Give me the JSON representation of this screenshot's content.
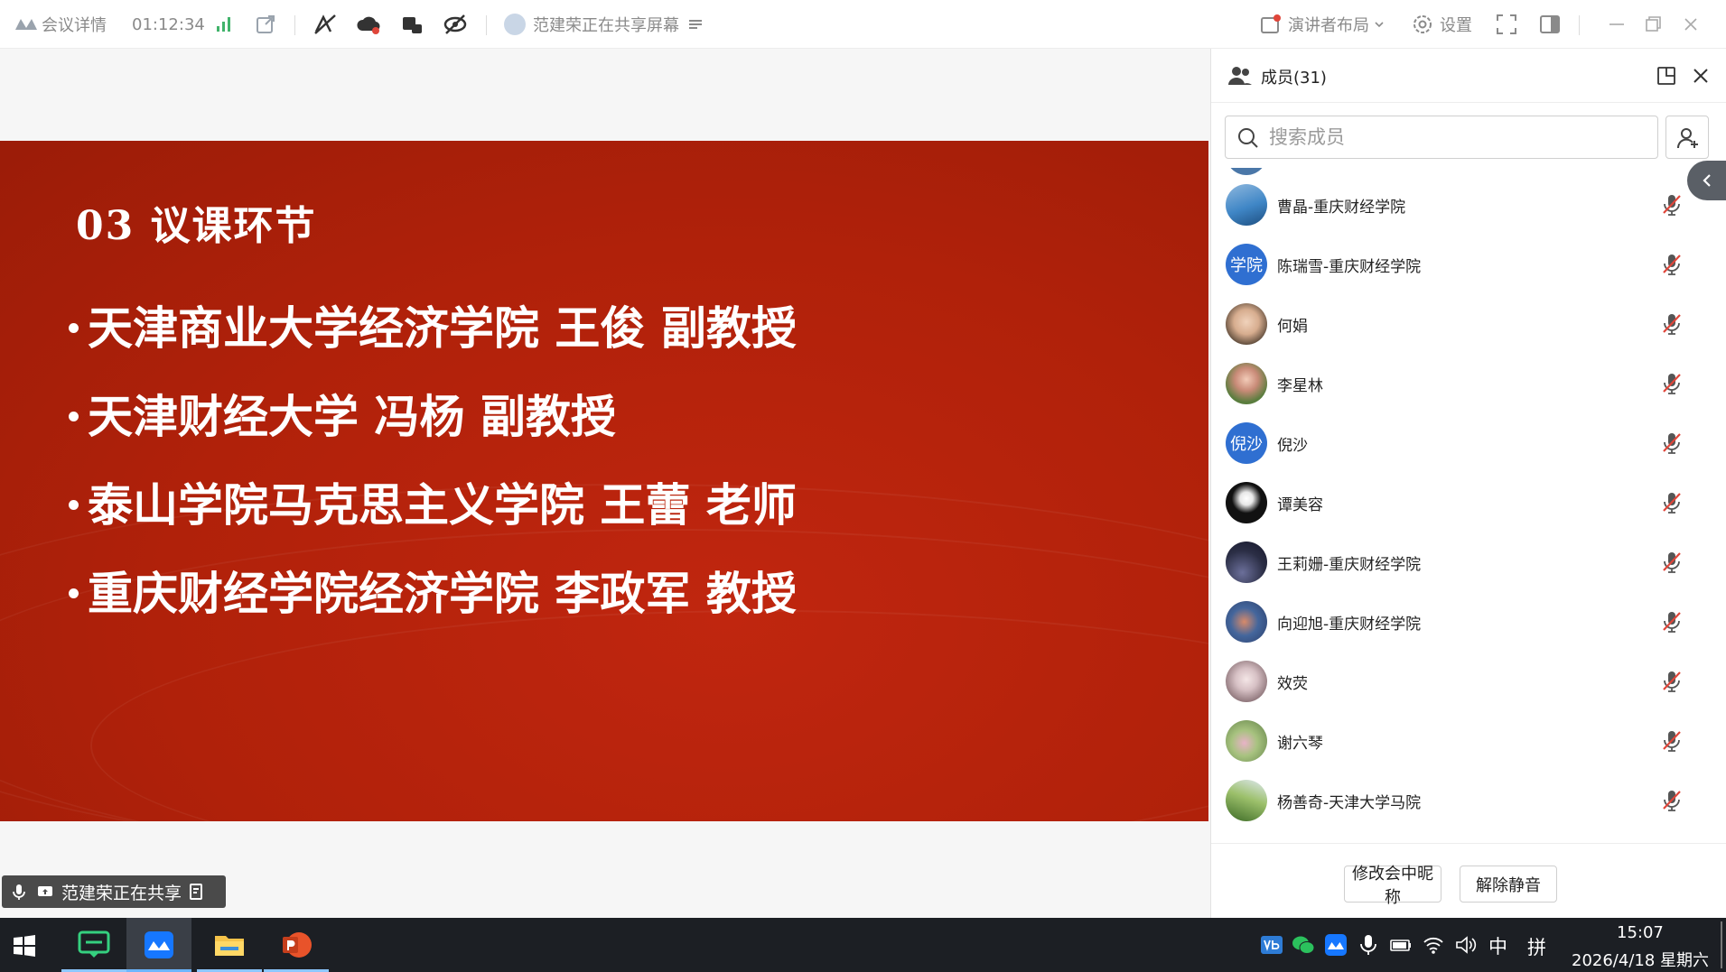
{
  "toolbar": {
    "meeting_details": "会议详情",
    "elapsed": "01:12:34",
    "sharing_status": "范建荣正在共享屏幕",
    "layout_label": "演讲者布局",
    "settings_label": "设置"
  },
  "slide": {
    "title": "03 议课环节",
    "lines": [
      "天津商业大学经济学院 王俊 副教授",
      "天津财经大学 冯杨 副教授",
      "泰山学院马克思主义学院 王蕾 老师",
      "重庆财经学院经济学院 李政军 教授"
    ]
  },
  "share_tag": "范建荣正在共享",
  "panel": {
    "title": "成员(31)",
    "search_placeholder": "搜索成员",
    "members": [
      {
        "name": "曹晶-重庆财经学院",
        "avatar_text": "",
        "avatar_color": "#3f86c6"
      },
      {
        "name": "陈瑞雪-重庆财经学院",
        "avatar_text": "学院",
        "avatar_color": "#2f6fd1"
      },
      {
        "name": "何娟",
        "avatar_text": "",
        "avatar_color": "#8f7a66"
      },
      {
        "name": "李星林",
        "avatar_text": "",
        "avatar_color": "#5a7d3e"
      },
      {
        "name": "倪沙",
        "avatar_text": "倪沙",
        "avatar_color": "#2f6fd1"
      },
      {
        "name": "谭美容",
        "avatar_text": "",
        "avatar_color": "#111111"
      },
      {
        "name": "王莉姗-重庆财经学院",
        "avatar_text": "",
        "avatar_color": "#2b2e45"
      },
      {
        "name": "向迎旭-重庆财经学院",
        "avatar_text": "",
        "avatar_color": "#44669c"
      },
      {
        "name": "效荧",
        "avatar_text": "",
        "avatar_color": "#b9a2a8"
      },
      {
        "name": "谢六琴",
        "avatar_text": "",
        "avatar_color": "#7a9b5c"
      },
      {
        "name": "杨善奇-天津大学马院",
        "avatar_text": "",
        "avatar_color": "#4f7d34"
      }
    ],
    "rename_button": "修改会中昵称",
    "unmute_button": "解除静音"
  },
  "taskbar": {
    "time": "15:07",
    "date": "2026/4/18 星期六",
    "ime_lang": "中",
    "ime_mode": "拼"
  },
  "colors": {
    "slide_red": "#b0210a",
    "accent_blue": "#2f6fd1",
    "mic_muted": "#e0463a"
  }
}
